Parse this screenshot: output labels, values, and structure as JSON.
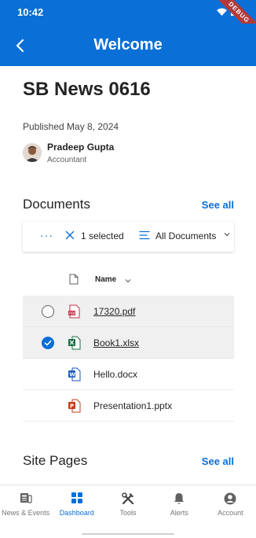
{
  "status_bar": {
    "time": "10:42",
    "debug_label": "DEBUG"
  },
  "app_bar": {
    "title": "Welcome"
  },
  "news": {
    "title": "SB News 0616",
    "published": "Published May 8, 2024",
    "author_name": "Pradeep Gupta",
    "author_role": "Accountant"
  },
  "documents": {
    "heading": "Documents",
    "see_all": "See all",
    "toolbar": {
      "more": "···",
      "selected": "1 selected",
      "view": "All Documents"
    },
    "column_name": "Name",
    "files": [
      {
        "name": "17320.pdf",
        "type": "pdf",
        "selected": false,
        "highlighted": true,
        "underlined": true
      },
      {
        "name": "Book1.xlsx",
        "type": "xlsx",
        "selected": true,
        "highlighted": true,
        "underlined": true
      },
      {
        "name": "Hello.docx",
        "type": "docx",
        "selected": false,
        "highlighted": false,
        "underlined": false
      },
      {
        "name": "Presentation1.pptx",
        "type": "pptx",
        "selected": false,
        "highlighted": false,
        "underlined": false
      }
    ]
  },
  "site_pages": {
    "heading": "Site Pages",
    "see_all": "See all"
  },
  "tabs": [
    {
      "label": "News & Events",
      "icon": "news-icon",
      "active": false
    },
    {
      "label": "Dashboard",
      "icon": "dashboard-icon",
      "active": true
    },
    {
      "label": "Tools",
      "icon": "tools-icon",
      "active": false
    },
    {
      "label": "Alerts",
      "icon": "bell-icon",
      "active": false
    },
    {
      "label": "Account",
      "icon": "account-icon",
      "active": false
    }
  ],
  "colors": {
    "brand": "#0a6fd6",
    "debug": "#b33a3a",
    "pdf": "#c4314b",
    "xlsx": "#1d7044",
    "docx": "#185abd",
    "pptx": "#c43e1c"
  }
}
